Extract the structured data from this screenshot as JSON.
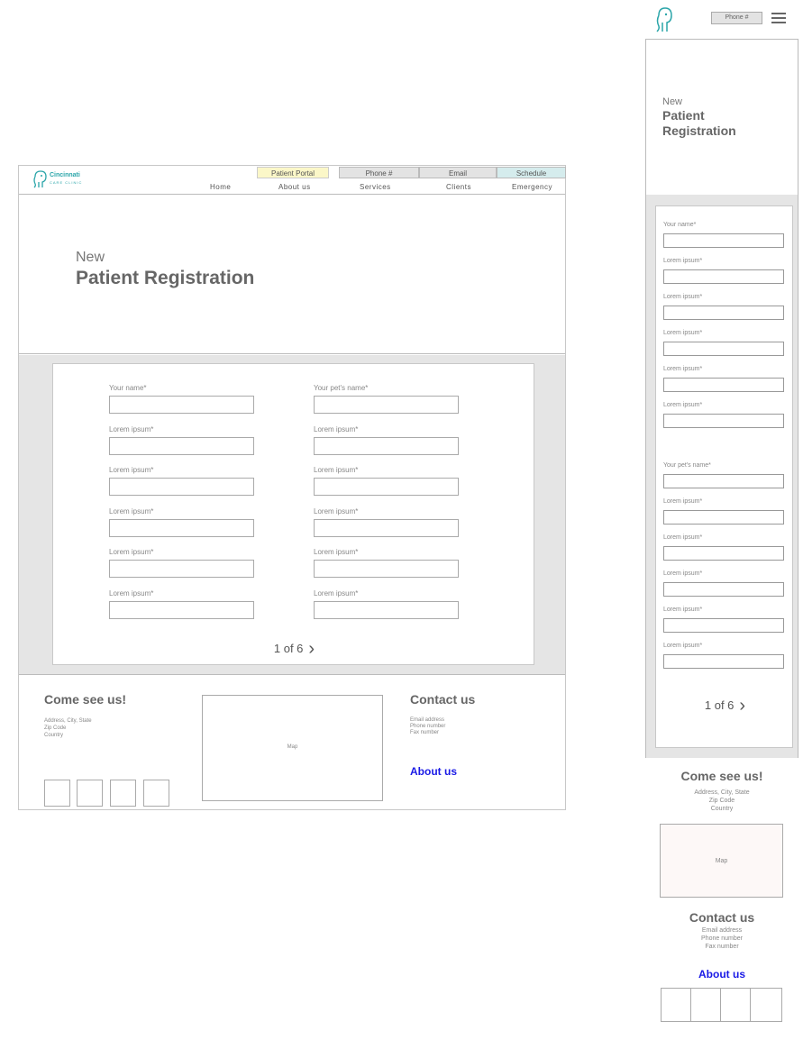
{
  "desktop": {
    "logo": {
      "name": "Cincinnati",
      "sub": "CARE CLINIC",
      "icon": "elephant-logo-icon"
    },
    "top_links": {
      "patient_portal": "Patient Portal",
      "phone": "Phone #",
      "email": "Email",
      "schedule": "Schedule"
    },
    "nav": {
      "home": "Home",
      "about": "About us",
      "services": "Services",
      "clients": "Clients",
      "emergency": "Emergency"
    },
    "hero": {
      "new": "New",
      "title": "Patient Registration"
    },
    "form": {
      "left_labels": [
        "Your name*",
        "Lorem ipsum*",
        "Lorem ipsum*",
        "Lorem ipsum*",
        "Lorem ipsum*",
        "Lorem ipsum*"
      ],
      "right_labels": [
        "Your pet's name*",
        "Lorem ipsum*",
        "Lorem ipsum*",
        "Lorem ipsum*",
        "Lorem ipsum*",
        "Lorem ipsum*"
      ],
      "pager": "1 of 6"
    },
    "footer": {
      "come_see_us": "Come see us!",
      "address_lines": [
        "Address, City, State",
        "Zip Code",
        "Country"
      ],
      "map": "Map",
      "contact_us": "Contact us",
      "contact_lines": [
        "Email address",
        "Phone number",
        "Fax number"
      ],
      "about_us": "About us"
    }
  },
  "mobile": {
    "phone": "Phone #",
    "hero": {
      "new": "New",
      "title": "Patient Registration"
    },
    "form": {
      "labels": [
        "Your name*",
        "Lorem ipsum*",
        "Lorem ipsum*",
        "Lorem ipsum*",
        "Lorem ipsum*",
        "Lorem ipsum*",
        "Your pet's name*",
        "Lorem ipsum*",
        "Lorem ipsum*",
        "Lorem ipsum*",
        "Lorem ipsum*",
        "Lorem ipsum*"
      ],
      "pager": "1 of 6"
    },
    "footer": {
      "come_see_us": "Come see us!",
      "address_lines": [
        "Address, City, State",
        "Zip Code",
        "Country"
      ],
      "map": "Map",
      "contact_us": "Contact us",
      "contact_lines": [
        "Email address",
        "Phone number",
        "Fax number"
      ],
      "about_us": "About us"
    }
  },
  "colors": {
    "accent_teal": "#2aa5a9",
    "portal_yellow": "#fbf7c8",
    "schedule_teal": "#d5eced",
    "link_blue": "#1a1ae6",
    "form_bg": "#e5e5e5"
  }
}
